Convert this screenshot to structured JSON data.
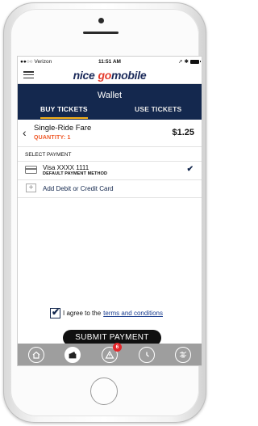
{
  "status_bar": {
    "carrier": "●●○○ Verizon",
    "wifi_icon": "wifi-icon",
    "time": "11:51 AM",
    "icons": "location-icon bluetooth-icon battery-icon"
  },
  "app": {
    "logo_nice": "nice",
    "logo_go": "go",
    "logo_mobile": "mobile",
    "brand_navy": "#14284e",
    "brand_red": "#e53b2c"
  },
  "wallet": {
    "title": "Wallet",
    "tabs": [
      {
        "label": "BUY TICKETS",
        "active": true
      },
      {
        "label": "USE TICKETS",
        "active": false
      }
    ]
  },
  "fare": {
    "name": "Single-Ride Fare",
    "quantity": "QUANTITY: 1",
    "price": "$1.25"
  },
  "payment": {
    "section_label": "SELECT PAYMENT",
    "card_name": "Visa XXXX 1111",
    "card_sub": "DEFAULT PAYMENT METHOD",
    "add_label": "Add Debit or Credit Card"
  },
  "terms": {
    "prefix": "I agree to the",
    "link": "terms and conditions",
    "checked": true
  },
  "submit": {
    "label": "SUBMIT PAYMENT"
  },
  "bottom_nav": {
    "items": [
      "home-icon",
      "wallet-icon",
      "alerts-icon",
      "clock-icon",
      "map-icon"
    ],
    "badge": "6"
  }
}
